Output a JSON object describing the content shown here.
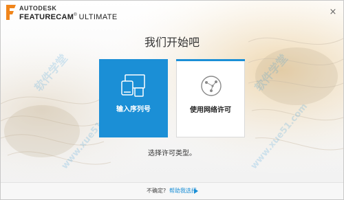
{
  "window": {
    "brand": "AUTODESK",
    "product_strong": "FEATURECAM",
    "product_trademark": "®",
    "product_edition": "ULTIMATE",
    "close_glyph": "×"
  },
  "heading": "我们开始吧",
  "cards": {
    "serial": {
      "label": "输入序列号",
      "icon": "devices-icon",
      "selected": true
    },
    "network": {
      "label": "使用网络许可",
      "icon": "network-globe-icon",
      "selected": false
    }
  },
  "prompt": "选择许可类型。",
  "footer": {
    "question": "不确定?",
    "help_link": "帮助我选择"
  },
  "watermarks": [
    "软件学堂",
    "软件学堂",
    "www.xue51.com",
    "www.xue51.com"
  ],
  "colors": {
    "accent": "#1b8fd6",
    "logo_orange": "#f0851b"
  }
}
